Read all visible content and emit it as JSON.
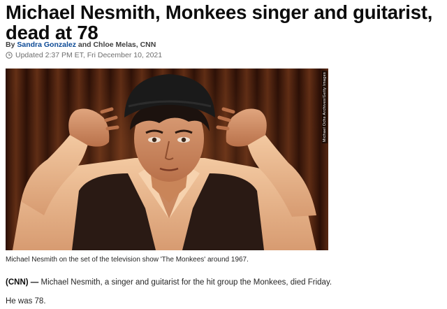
{
  "article": {
    "headline": "Michael Nesmith, Monkees singer and guitarist, dead at 78",
    "byline": {
      "prefix": "By",
      "author1": "Sandra Gonzalez",
      "connector": "and Chloe Melas, CNN"
    },
    "updated": "Updated 2:37 PM ET, Fri December 10, 2021",
    "image": {
      "credit": "Michael Ochs Archives/Getty Images",
      "caption": "Michael Nesmith on the set of the television show 'The Monkees' around 1967."
    },
    "body": {
      "dateline": "(CNN) —",
      "paragraph1": "Michael Nesmith, a singer and guitarist for the hit group the Monkees, died Friday.",
      "paragraph2": "He was 78."
    }
  },
  "colors": {
    "byline_link": "#0c4a96",
    "headline": "#0c0c0c",
    "meta": "#6e6e6e"
  },
  "icons": {
    "updated": "clock-icon"
  }
}
